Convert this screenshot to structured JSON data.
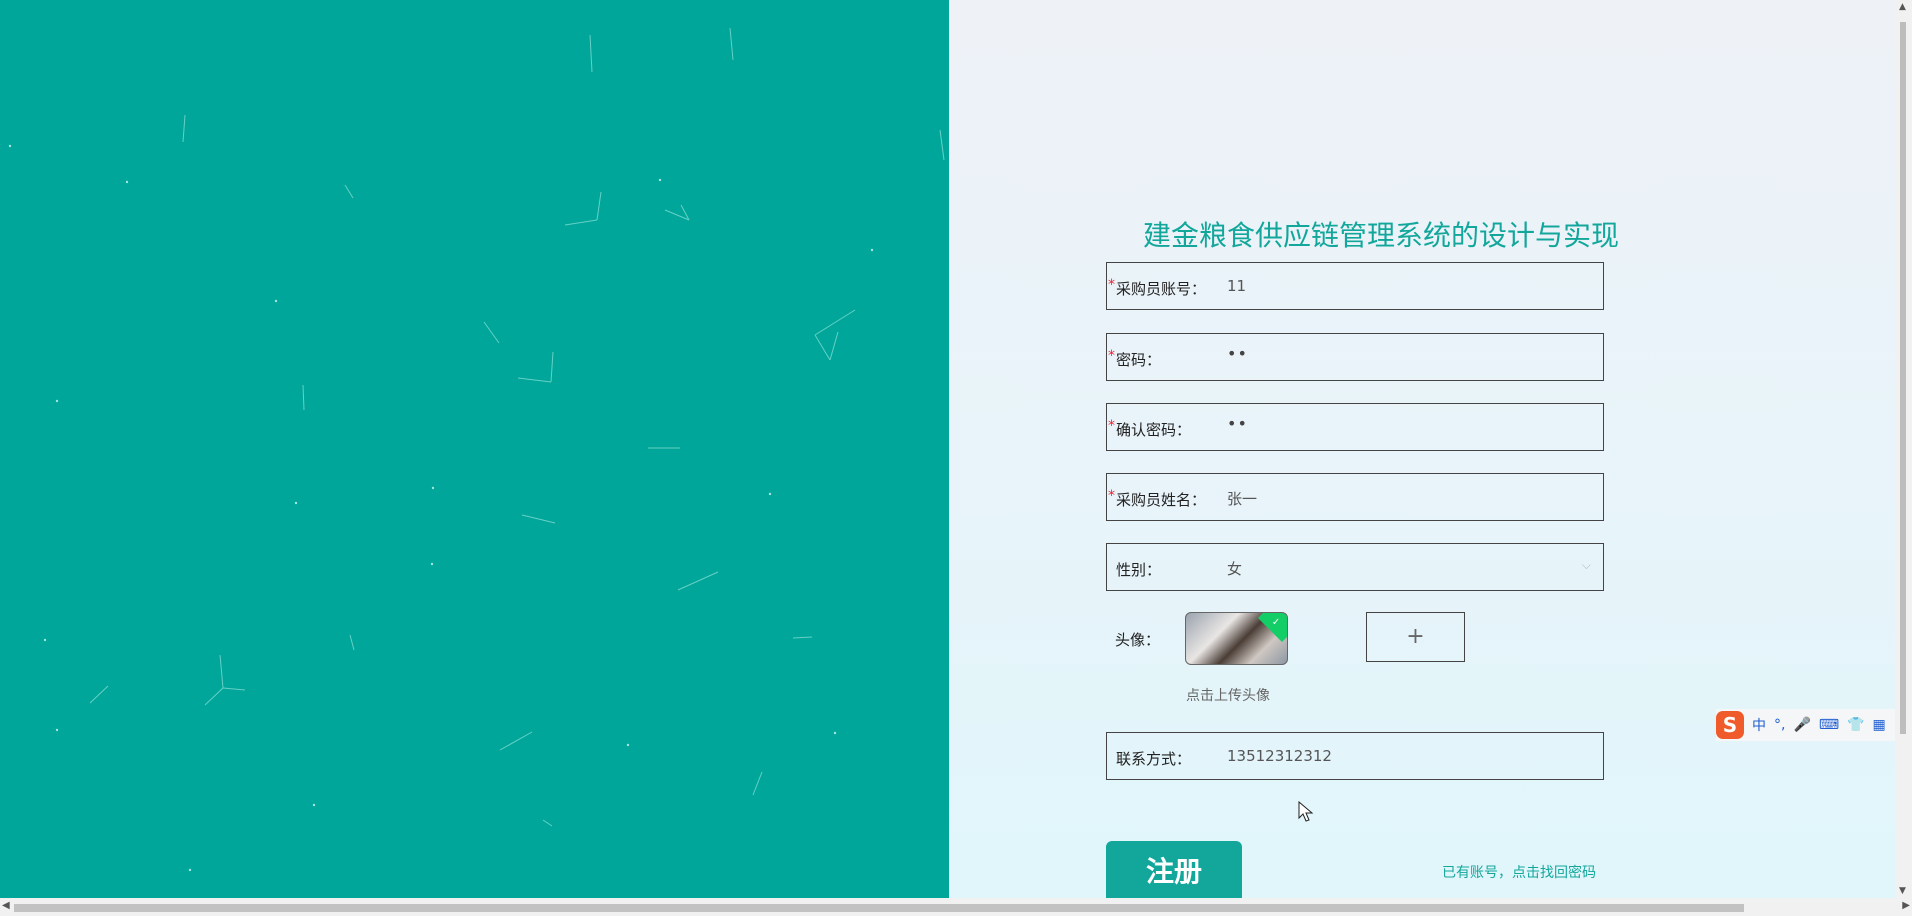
{
  "colors": {
    "accent": "#13a79c",
    "left_panel": "#00a69a",
    "required": "#e22233"
  },
  "page": {
    "title": "建金粮食供应链管理系统的设计与实现"
  },
  "form": {
    "account": {
      "label": "采购员账号：",
      "value": "11",
      "required": "*"
    },
    "password": {
      "label": "密码：",
      "value": "••",
      "required": "*"
    },
    "confirm": {
      "label": "确认密码：",
      "value": "••",
      "required": "*"
    },
    "name": {
      "label": "采购员姓名：",
      "value": "张一",
      "required": "*"
    },
    "gender": {
      "label": "性别：",
      "value": "女"
    },
    "avatar": {
      "label": "头像：",
      "hint": "点击上传头像",
      "upload_icon": "+"
    },
    "phone": {
      "label": "联系方式：",
      "value": "13512312312"
    }
  },
  "actions": {
    "register": "注册",
    "login_link": "已有账号，点击找回密码"
  },
  "ime": {
    "logo": "S",
    "mode": "中",
    "punct": "°,"
  }
}
